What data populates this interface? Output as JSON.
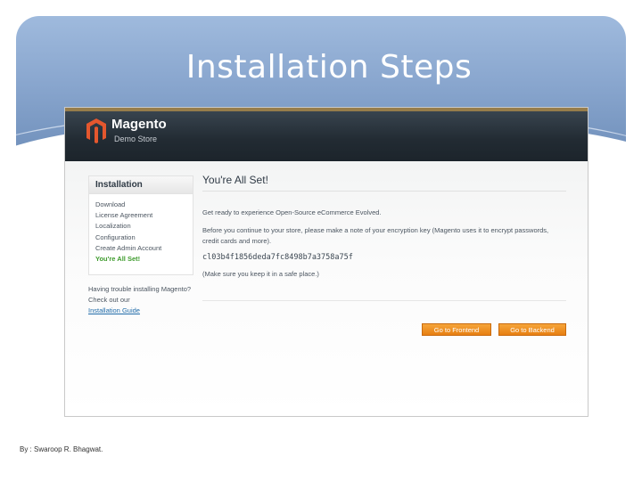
{
  "slide": {
    "title": "Installation Steps",
    "footer": "By : Swaroop R. Bhagwat."
  },
  "app": {
    "brand_name": "Magento",
    "brand_sub": "Demo Store",
    "brand_color": "#e4572e"
  },
  "sidebar": {
    "heading": "Installation",
    "items": [
      {
        "label": "Download"
      },
      {
        "label": "License Agreement"
      },
      {
        "label": "Localization"
      },
      {
        "label": "Configuration"
      },
      {
        "label": "Create Admin Account"
      },
      {
        "label": "You're All Set!"
      }
    ],
    "help_text": "Having trouble installing Magento? Check out our",
    "help_link": "Installation Guide"
  },
  "main": {
    "title": "You're All Set!",
    "intro": "Get ready to experience Open-Source eCommerce Evolved.",
    "note": "Before you continue to your store, please make a note of your encryption key (Magento uses it to encrypt passwords, credit cards and more).",
    "encryption_key": "cl03b4f1856deda7fc8498b7a3758a75f",
    "reminder": "(Make sure you keep it in a safe place.)"
  },
  "buttons": {
    "frontend": "Go to Frontend",
    "backend": "Go to Backend",
    "color": "#f0911f"
  }
}
